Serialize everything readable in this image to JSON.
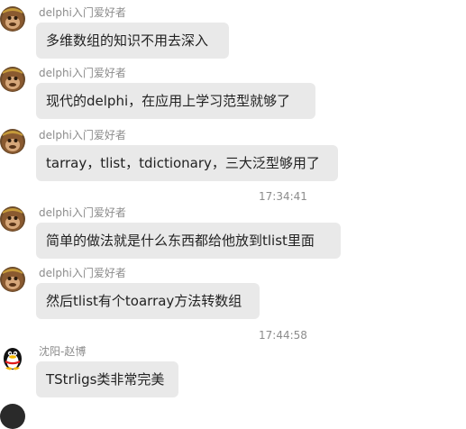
{
  "messages": [
    {
      "sender": "delphi入门爱好者",
      "text": "多维数组的知识不用去深入",
      "avatar": "monkey-avatar"
    },
    {
      "sender": "delphi入门爱好者",
      "text": "现代的delphi，在应用上学习范型就够了",
      "avatar": "monkey-avatar"
    },
    {
      "sender": "delphi入门爱好者",
      "text": "tarray，tlist，tdictionary，三大泛型够用了",
      "avatar": "monkey-avatar"
    },
    {
      "sender": "delphi入门爱好者",
      "text": "简单的做法就是什么东西都给他放到tlist里面",
      "avatar": "monkey-avatar"
    },
    {
      "sender": "delphi入门爱好者",
      "text": "然后tlist有个toarray方法转数组",
      "avatar": "monkey-avatar"
    },
    {
      "sender": "沈阳-赵博",
      "text": "TStrligs类非常完美",
      "avatar": "penguin-avatar"
    }
  ],
  "timestamps": [
    "17:34:41",
    "17:44:58"
  ],
  "colors": {
    "bubble": "#e9e9e9",
    "sender_text": "#8c8c8c",
    "message_text": "#222222"
  }
}
